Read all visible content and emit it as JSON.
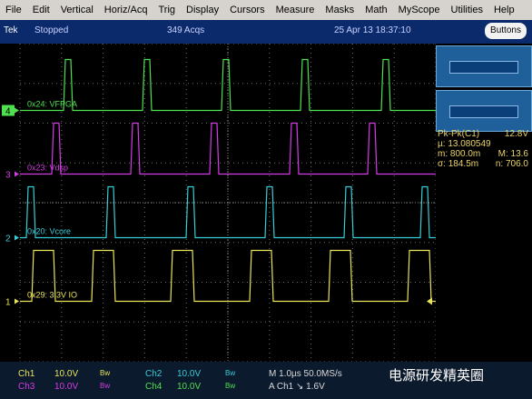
{
  "menu": [
    "File",
    "Edit",
    "Vertical",
    "Horiz/Acq",
    "Trig",
    "Display",
    "Cursors",
    "Measure",
    "Masks",
    "Math",
    "MyScope",
    "Utilities",
    "Help"
  ],
  "status": {
    "brand": "Tek",
    "state": "Stopped",
    "acqs": "349 Acqs",
    "datetime": "25 Apr 13 18:37:10",
    "buttons_label": "Buttons"
  },
  "channels": [
    {
      "marker": "4",
      "label": "0x24: VFPGA",
      "color": "#4fe04f",
      "level": 0.79
    },
    {
      "marker": "3",
      "label": "0x23: Vdsp",
      "color": "#d53be6",
      "level": 0.59
    },
    {
      "marker": "2",
      "label": "0x20: Vcore",
      "color": "#37cdd6",
      "level": 0.39
    },
    {
      "marker": "1",
      "label": "0x29: 3.3V IO",
      "color": "#e9e35c",
      "level": 0.19
    }
  ],
  "measurement": {
    "title": "Pk-Pk(C1)",
    "title_value": "12.8V",
    "mu_label": "µ:",
    "mu_value": "13.080549",
    "m_label": "m:",
    "m_value": "800.0m",
    "M_label": "M:",
    "M_value": "13.6",
    "sigma_label": "σ:",
    "sigma_value": "184.5m",
    "n_label": "n:",
    "n_value": "706.0"
  },
  "bottom": {
    "ch1": "Ch1",
    "ch1_v": "10.0V",
    "bw": "Bw",
    "ch2": "Ch2",
    "ch2_v": "10.0V",
    "ch3": "Ch3",
    "ch3_v": "10.0V",
    "ch4": "Ch4",
    "ch4_v": "10.0V",
    "timebase": "M 1.0µs 50.0MS/s",
    "trigger": "A  Ch1  ↘  1.6V",
    "watermark": "电源研发精英圈"
  },
  "colors": {
    "grid": "#6c6c6c",
    "accent": "#0b2a6c"
  }
}
